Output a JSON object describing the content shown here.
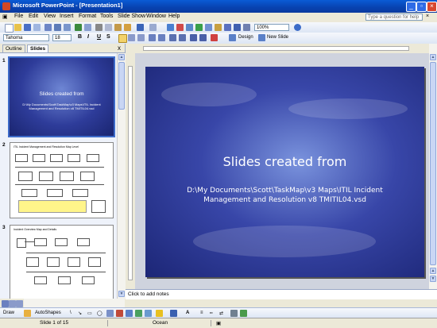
{
  "window": {
    "title": "Microsoft PowerPoint - [Presentation1]"
  },
  "menu": [
    "File",
    "Edit",
    "View",
    "Insert",
    "Format",
    "Tools",
    "Slide Show",
    "Window",
    "Help"
  ],
  "help_placeholder": "Type a question for help",
  "toolbar": {
    "zoom": "100%",
    "font": "Tahoma",
    "font_size": "18",
    "bold": "B",
    "italic": "I",
    "underline": "U",
    "shadow": "S",
    "design_label": "Design",
    "new_slide_label": "New Slide"
  },
  "pane": {
    "tab_outline": "Outline",
    "tab_slides": "Slides",
    "close": "x"
  },
  "thumbnails": [
    {
      "number": "1",
      "title": "Slides created from",
      "subtitle": "D:\\My Documents\\Scott\\TaskMap\\v3 Maps\\ITIL Incident Management and Resolution v8 TMITIL04.vsd"
    },
    {
      "number": "2",
      "title": "ITIL Incident Management and Resolution Map Level"
    },
    {
      "number": "3",
      "title": "Incident Overview Map and Details"
    }
  ],
  "slide": {
    "title": "Slides created from",
    "subtitle": "D:\\My Documents\\Scott\\TaskMap\\v3 Maps\\ITIL Incident Management and Resolution v8 TMITIL04.vsd"
  },
  "notes_placeholder": "Click to add notes",
  "drawbar": {
    "draw_label": "Draw",
    "autoshapes_label": "AutoShapes"
  },
  "status": {
    "slide_pos": "Slide 1 of 15",
    "design": "Ocean"
  },
  "colors": {
    "title_bar": "#0A4FC6",
    "slide_blue": "#3846A8",
    "toolbar": "#DCE5F4",
    "selection": "#3D6BC9"
  }
}
